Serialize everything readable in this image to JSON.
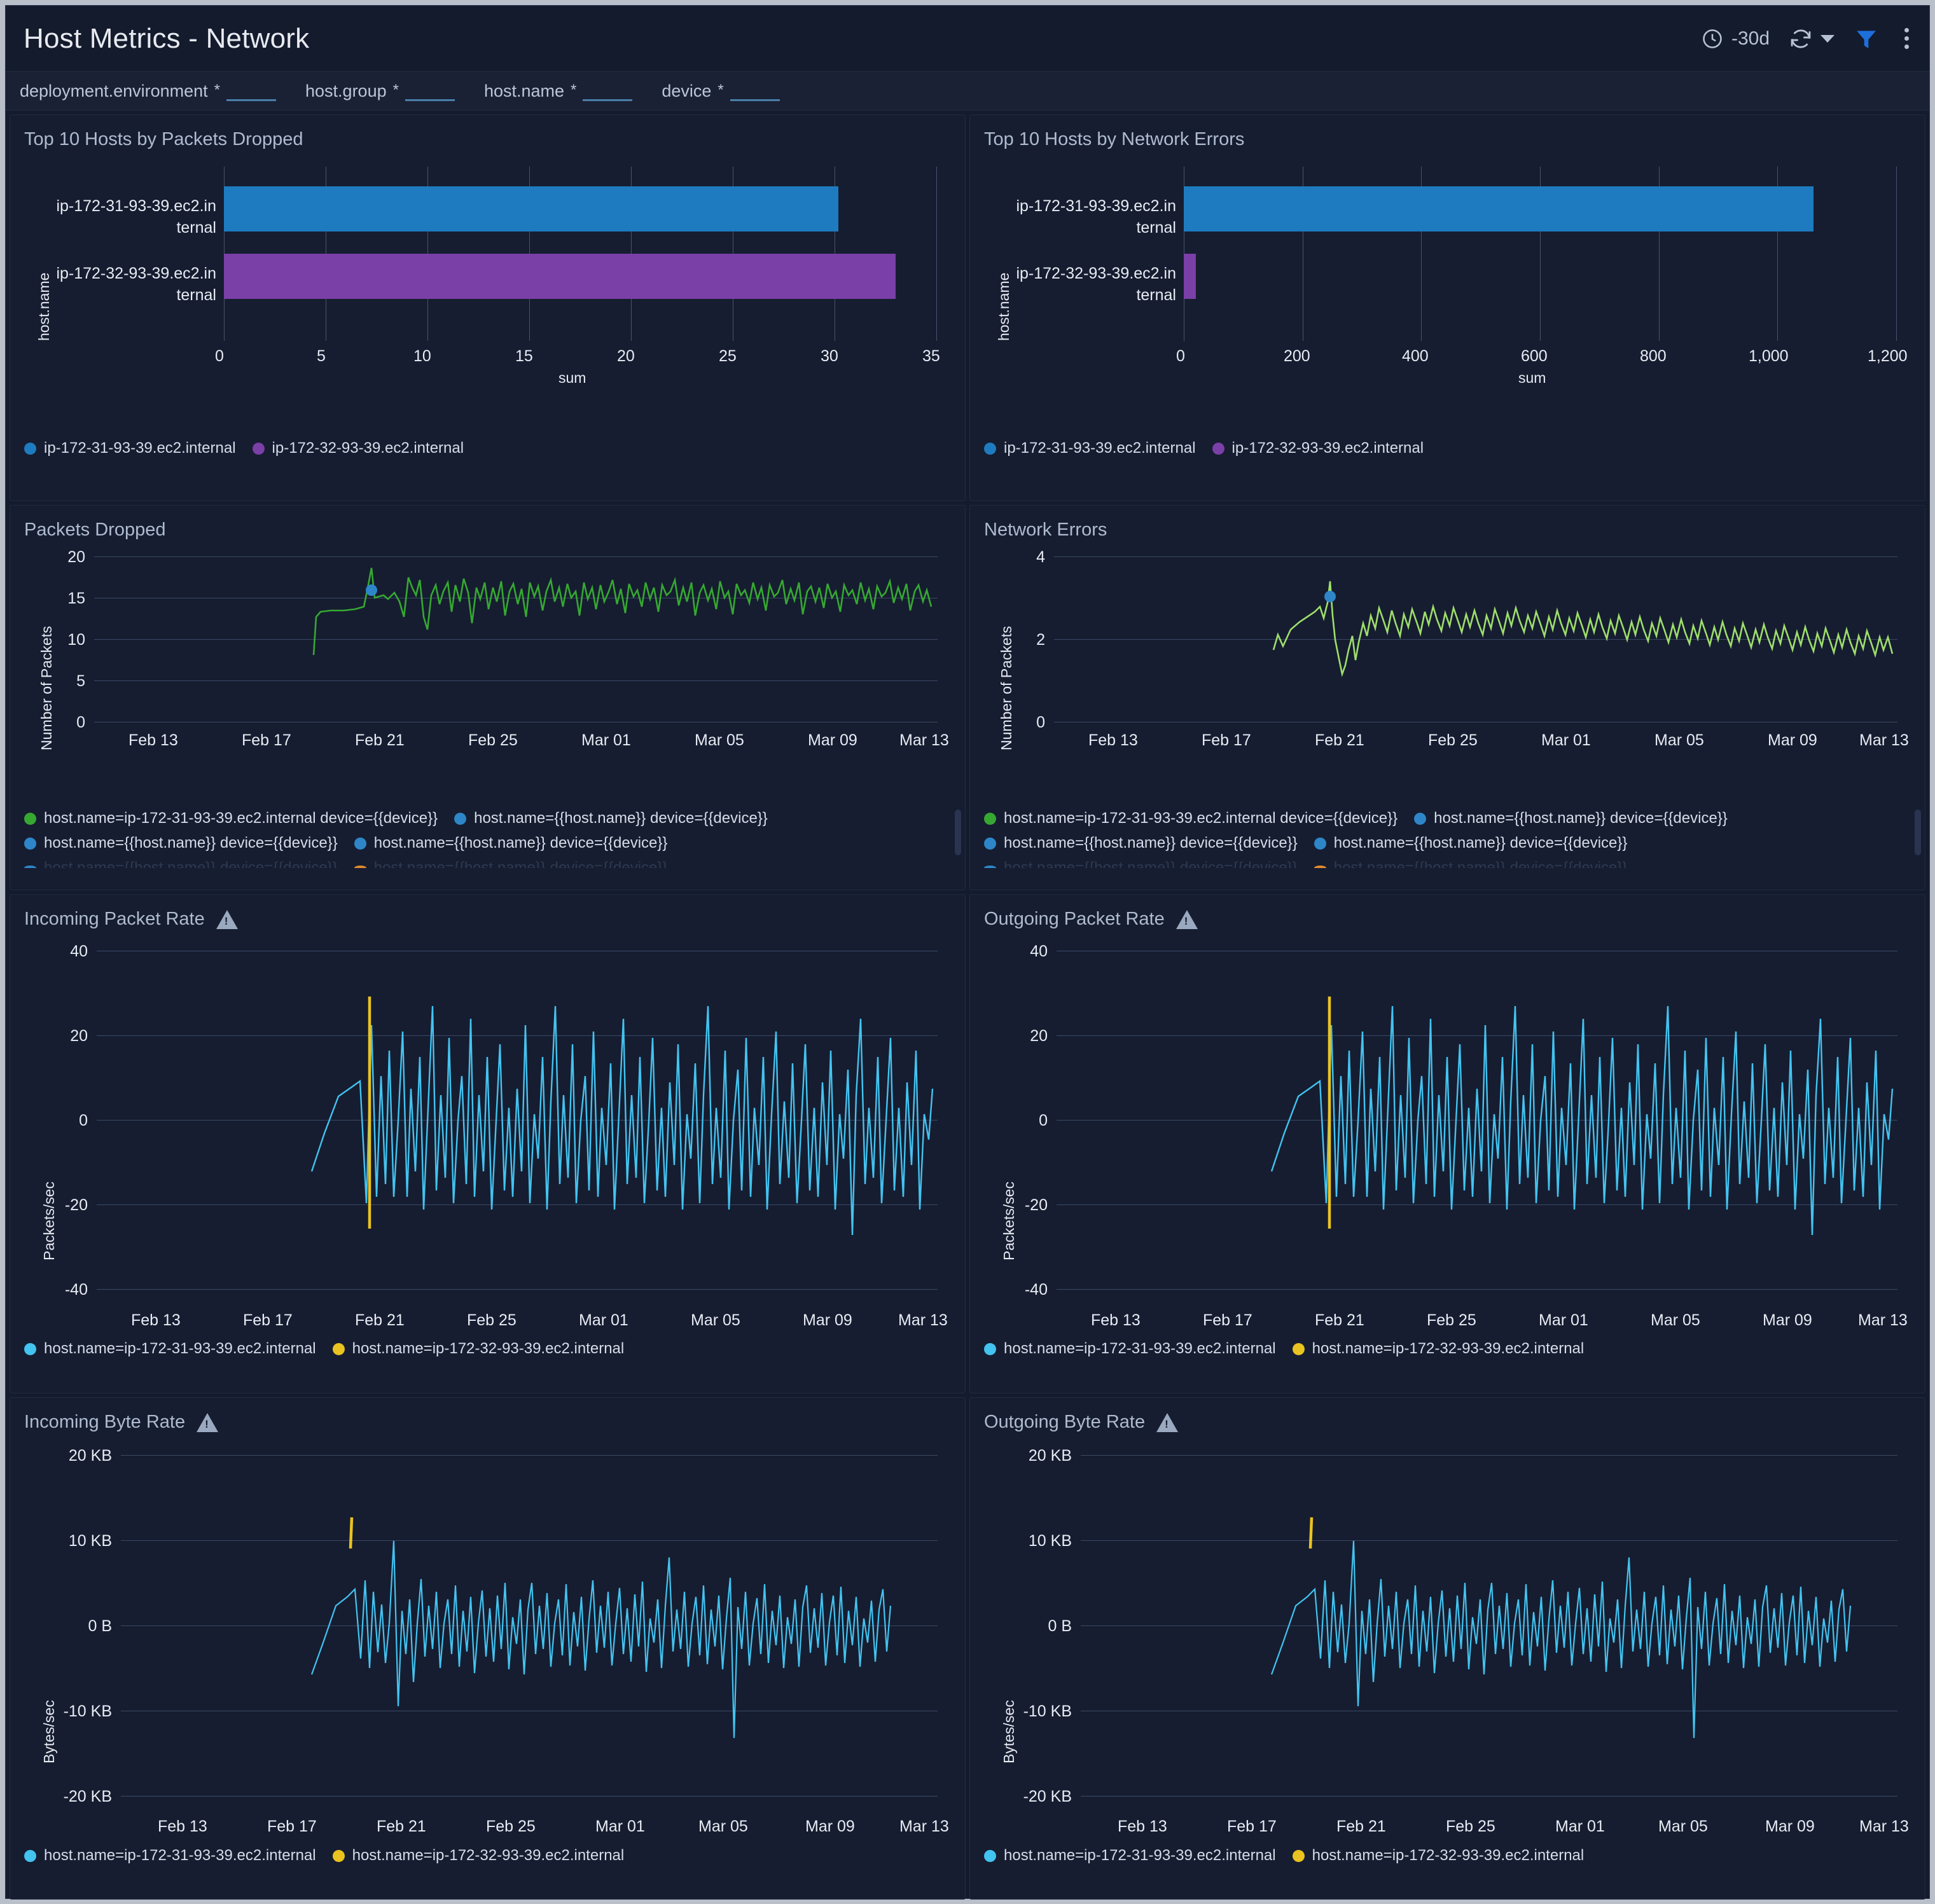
{
  "header": {
    "title": "Host Metrics - Network",
    "time_range": "-30d",
    "icons": {
      "clock": "clock-icon",
      "refresh": "refresh-icon",
      "filter": "filter-funnel-icon",
      "menu": "overflow-menu-icon"
    },
    "accent_color": "#1d6fdb"
  },
  "filters": [
    {
      "name": "deployment.environment",
      "star": "*",
      "value": ""
    },
    {
      "name": "host.group",
      "star": "*",
      "value": ""
    },
    {
      "name": "host.name",
      "star": "*",
      "value": ""
    },
    {
      "name": "device",
      "star": "*",
      "value": ""
    }
  ],
  "hosts": {
    "a": "ip-172-31-93-39.ec2.internal",
    "b": "ip-172-32-93-39.ec2.internal",
    "a_wrap1": "ip-172-31-93-39.ec2.in",
    "a_wrap2": "ternal",
    "b_wrap1": "ip-172-32-93-39.ec2.in",
    "b_wrap2": "ternal"
  },
  "colors": {
    "blue": "#1f7bbf",
    "purple": "#7b3fa8",
    "green": "#36a832",
    "lightgreen": "#9ede6c",
    "cyan": "#43c3f0",
    "gold": "#e9c320",
    "orange": "#e08a30",
    "steelblue": "#2e86c8"
  },
  "panels": {
    "packets_dropped_top": {
      "title": "Top 10 Hosts by Packets Dropped"
    },
    "network_errors_top": {
      "title": "Top 10 Hosts by Network Errors"
    },
    "packets_dropped": {
      "title": "Packets Dropped"
    },
    "network_errors": {
      "title": "Network Errors"
    },
    "incoming_packet_rate": {
      "title": "Incoming Packet Rate",
      "warning": "warning-icon"
    },
    "outgoing_packet_rate": {
      "title": "Outgoing Packet Rate",
      "warning": "warning-icon"
    },
    "incoming_byte_rate": {
      "title": "Incoming Byte Rate",
      "warning": "warning-icon"
    },
    "outgoing_byte_rate": {
      "title": "Outgoing Byte Rate",
      "warning": "warning-icon"
    }
  },
  "legends": {
    "device_series": [
      "host.name=ip-172-31-93-39.ec2.internal device={{device}}",
      "host.name={{host.name}} device={{device}}",
      "host.name={{host.name}} device={{device}}",
      "host.name={{host.name}} device={{device}}"
    ],
    "host_series": [
      "host.name=ip-172-31-93-39.ec2.internal",
      "host.name=ip-172-32-93-39.ec2.internal"
    ]
  },
  "chart_data": [
    {
      "id": "top-packets-dropped",
      "type": "bar",
      "orientation": "horizontal",
      "title": "Top 10 Hosts by Packets Dropped",
      "ylabel": "host.name",
      "xlabel": "sum",
      "categories": [
        "ip-172-31-93-39.ec2.internal",
        "ip-172-32-93-39.ec2.internal"
      ],
      "values": [
        30.2,
        33.0
      ],
      "bar_colors": [
        "#1f7bbf",
        "#7b3fa8"
      ],
      "xlim": [
        0,
        35
      ],
      "xticks": [
        0,
        5,
        10,
        15,
        20,
        25,
        30,
        35
      ],
      "xtick_labels": [
        "0",
        "5",
        "10",
        "15",
        "20",
        "25",
        "30",
        "35"
      ],
      "grid": true,
      "legend_position": "bottom",
      "legend": [
        "ip-172-31-93-39.ec2.internal",
        "ip-172-32-93-39.ec2.internal"
      ]
    },
    {
      "id": "top-network-errors",
      "type": "bar",
      "orientation": "horizontal",
      "title": "Top 10 Hosts by Network Errors",
      "ylabel": "host.name",
      "xlabel": "sum",
      "categories": [
        "ip-172-31-93-39.ec2.internal",
        "ip-172-32-93-39.ec2.internal"
      ],
      "values": [
        1060,
        20
      ],
      "bar_colors": [
        "#1f7bbf",
        "#7b3fa8"
      ],
      "xlim": [
        0,
        1200
      ],
      "xticks": [
        0,
        200,
        400,
        600,
        800,
        1000,
        1200
      ],
      "xtick_labels": [
        "0",
        "200",
        "400",
        "600",
        "800",
        "1,000",
        "1,200"
      ],
      "grid": true,
      "legend_position": "bottom",
      "legend": [
        "ip-172-31-93-39.ec2.internal",
        "ip-172-32-93-39.ec2.internal"
      ]
    },
    {
      "id": "packets-dropped",
      "type": "line",
      "title": "Packets Dropped",
      "ylabel": "Number of Packets",
      "xlabel": "",
      "ylim": [
        0,
        20
      ],
      "yticks": [
        0,
        5,
        10,
        15,
        20
      ],
      "ytick_labels": [
        "0",
        "5",
        "10",
        "15",
        "20"
      ],
      "xtick_labels": [
        "Feb 13",
        "Feb 17",
        "Feb 21",
        "Feb 25",
        "Mar 01",
        "Mar 05",
        "Mar 09",
        "Mar 13"
      ],
      "grid": true,
      "series": [
        {
          "name": "host.name=ip-172-31-93-39.ec2.internal device={{device}}",
          "color": "#36a832",
          "note": "noisy series beginning ~Feb 22, mean ~15, range 10.5-18.5"
        }
      ],
      "legend_position": "bottom"
    },
    {
      "id": "network-errors",
      "type": "line",
      "title": "Network Errors",
      "ylabel": "Number of Packets",
      "xlabel": "",
      "ylim": [
        0,
        4
      ],
      "yticks": [
        0,
        2,
        4
      ],
      "ytick_labels": [
        "0",
        "2",
        "4"
      ],
      "xtick_labels": [
        "Feb 13",
        "Feb 17",
        "Feb 21",
        "Feb 25",
        "Mar 01",
        "Mar 05",
        "Mar 09",
        "Mar 13"
      ],
      "grid": true,
      "series": [
        {
          "name": "host.name=ip-172-31-93-39.ec2.internal device={{device}}",
          "color": "#9ede6c",
          "note": "noisy series beginning ~Feb 22, mean ~2.5, range 1.5-3.4"
        }
      ],
      "legend_position": "bottom"
    },
    {
      "id": "incoming-packet-rate",
      "type": "line",
      "title": "Incoming Packet Rate",
      "ylabel": "Packets/sec",
      "ylim": [
        -40,
        40
      ],
      "yticks": [
        -40,
        -20,
        0,
        20,
        40
      ],
      "ytick_labels": [
        "-40",
        "-20",
        "0",
        "20",
        "40"
      ],
      "xtick_labels": [
        "Feb 13",
        "Feb 17",
        "Feb 21",
        "Feb 25",
        "Mar 01",
        "Mar 05",
        "Mar 09",
        "Mar 13"
      ],
      "grid": true,
      "series": [
        {
          "name": "host.name=ip-172-31-93-39.ec2.internal",
          "color": "#43c3f0",
          "note": "oscillating -30..+30 from Feb 22"
        },
        {
          "name": "host.name=ip-172-32-93-39.ec2.internal",
          "color": "#e9c320",
          "note": "single spike near Feb 23"
        }
      ],
      "legend_position": "bottom"
    },
    {
      "id": "outgoing-packet-rate",
      "type": "line",
      "title": "Outgoing Packet Rate",
      "ylabel": "Packets/sec",
      "ylim": [
        -40,
        40
      ],
      "yticks": [
        -40,
        -20,
        0,
        20,
        40
      ],
      "ytick_labels": [
        "-40",
        "-20",
        "0",
        "20",
        "40"
      ],
      "xtick_labels": [
        "Feb 13",
        "Feb 17",
        "Feb 21",
        "Feb 25",
        "Mar 01",
        "Mar 05",
        "Mar 09",
        "Mar 13"
      ],
      "grid": true,
      "series": [
        {
          "name": "host.name=ip-172-31-93-39.ec2.internal",
          "color": "#43c3f0",
          "note": "oscillating -30..+30 from Feb 22"
        },
        {
          "name": "host.name=ip-172-32-93-39.ec2.internal",
          "color": "#e9c320",
          "note": "single spike near Feb 23"
        }
      ],
      "legend_position": "bottom"
    },
    {
      "id": "incoming-byte-rate",
      "type": "line",
      "title": "Incoming Byte Rate",
      "ylabel": "Bytes/sec",
      "ylim": [
        -20000,
        20000
      ],
      "yticks": [
        -20000,
        -10000,
        0,
        10000,
        20000
      ],
      "ytick_labels": [
        "-20 KB",
        "-10 KB",
        "0 B",
        "10 KB",
        "20 KB"
      ],
      "xtick_labels": [
        "Feb 13",
        "Feb 17",
        "Feb 21",
        "Feb 25",
        "Mar 01",
        "Mar 05",
        "Mar 09",
        "Mar 13"
      ],
      "grid": true,
      "series": [
        {
          "name": "host.name=ip-172-31-93-39.ec2.internal",
          "color": "#43c3f0",
          "note": "oscillating -13KB..+11KB from Feb 22"
        },
        {
          "name": "host.name=ip-172-32-93-39.ec2.internal",
          "color": "#e9c320",
          "note": "single spike ~15KB near Feb 23"
        }
      ],
      "legend_position": "bottom"
    },
    {
      "id": "outgoing-byte-rate",
      "type": "line",
      "title": "Outgoing Byte Rate",
      "ylabel": "Bytes/sec",
      "ylim": [
        -20000,
        20000
      ],
      "yticks": [
        -20000,
        -10000,
        0,
        10000,
        20000
      ],
      "ytick_labels": [
        "-20 KB",
        "-10 KB",
        "0 B",
        "10 KB",
        "20 KB"
      ],
      "xtick_labels": [
        "Feb 13",
        "Feb 17",
        "Feb 21",
        "Feb 25",
        "Mar 01",
        "Mar 05",
        "Mar 09",
        "Mar 13"
      ],
      "grid": true,
      "series": [
        {
          "name": "host.name=ip-172-31-93-39.ec2.internal",
          "color": "#43c3f0",
          "note": "oscillating -13KB..+11KB from Feb 22"
        },
        {
          "name": "host.name=ip-172-32-93-39.ec2.internal",
          "color": "#e9c320",
          "note": "single spike ~15KB near Feb 23"
        }
      ],
      "legend_position": "bottom"
    }
  ]
}
